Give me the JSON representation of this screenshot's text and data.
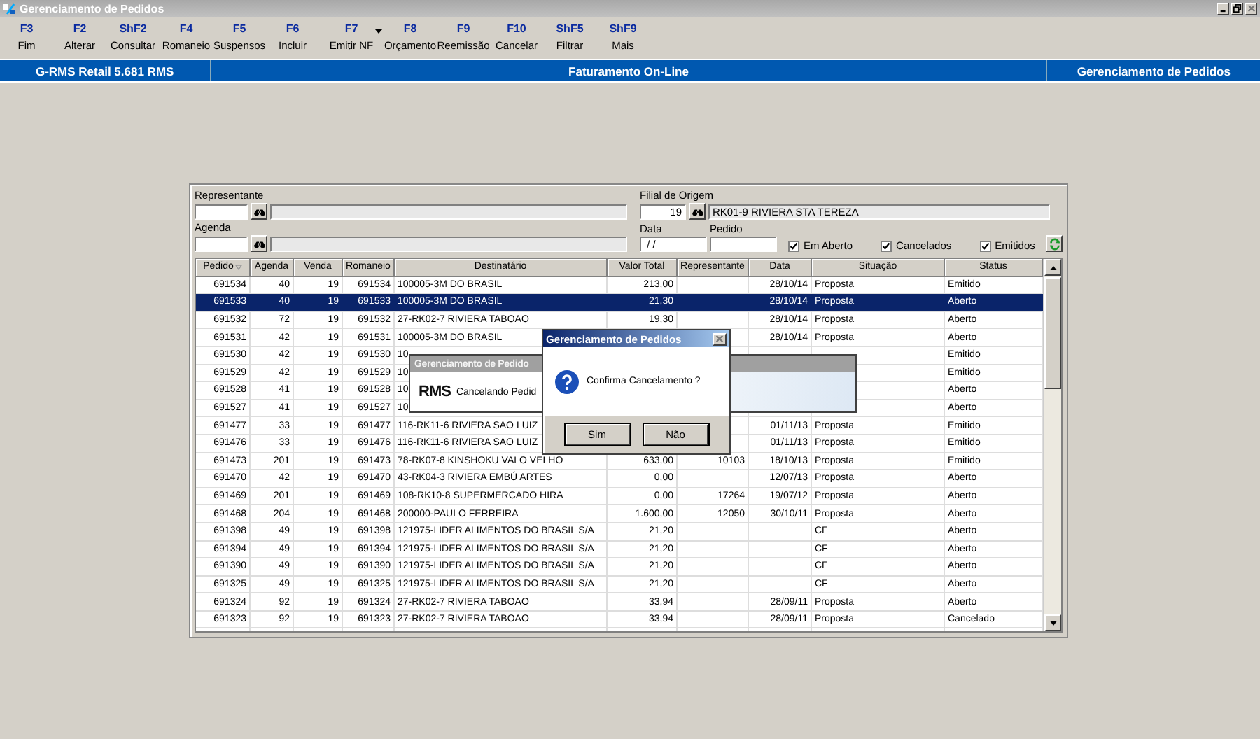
{
  "window": {
    "title": "Gerenciamento de Pedidos"
  },
  "toolbar": [
    {
      "key": "F3",
      "label": "Fim"
    },
    {
      "key": "F2",
      "label": "Alterar"
    },
    {
      "key": "ShF2",
      "label": "Consultar"
    },
    {
      "key": "F4",
      "label": "Romaneio"
    },
    {
      "key": "F5",
      "label": "Suspensos"
    },
    {
      "key": "F6",
      "label": "Incluir"
    },
    {
      "key": "F7",
      "label": "Emitir NF",
      "dropdown": true
    },
    {
      "key": "F8",
      "label": "Orçamento"
    },
    {
      "key": "F9",
      "label": "Reemissão"
    },
    {
      "key": "F10",
      "label": "Cancelar"
    },
    {
      "key": "ShF5",
      "label": "Filtrar"
    },
    {
      "key": "ShF9",
      "label": "Mais"
    }
  ],
  "status_bar": [
    "G-RMS Retail 5.681 RMS",
    "Faturamento On-Line",
    "Gerenciamento de Pedidos"
  ],
  "filters": {
    "representante": {
      "label": "Representante"
    },
    "agenda": {
      "label": "Agenda"
    },
    "filial": {
      "label": "Filial de Origem",
      "value": "19",
      "description": "RK01-9 RIVIERA STA TEREZA"
    },
    "data": {
      "label": "Data",
      "value": " / /"
    },
    "pedido": {
      "label": "Pedido"
    },
    "checkboxes": [
      {
        "label": "Em Aberto",
        "checked": true
      },
      {
        "label": "Cancelados",
        "checked": true
      },
      {
        "label": "Emitidos",
        "checked": true
      }
    ]
  },
  "table": {
    "columns": [
      {
        "label": "Pedido",
        "sorted": true
      },
      {
        "label": "Agenda",
        "sorted": false
      },
      {
        "label": "Venda",
        "sorted": false
      },
      {
        "label": "Romaneio",
        "sorted": false
      },
      {
        "label": "Destinatário",
        "sorted": false
      },
      {
        "label": "Valor Total",
        "sorted": false
      },
      {
        "label": "Representante",
        "sorted": false
      },
      {
        "label": "Data",
        "sorted": false
      },
      {
        "label": "Situação",
        "sorted": false
      },
      {
        "label": "Status",
        "sorted": false
      }
    ],
    "rows": [
      {
        "selected": false,
        "pedido": "691534",
        "agenda": "40",
        "venda": "19",
        "romaneio": "691534",
        "destinatario": "100005-3M DO BRASIL",
        "valor_total": "213,00",
        "data": "28/10/14",
        "situacao": "Proposta",
        "status": "Emitido"
      },
      {
        "selected": true,
        "pedido": "691533",
        "agenda": "40",
        "venda": "19",
        "romaneio": "691533",
        "destinatario": "100005-3M DO BRASIL",
        "valor_total": "21,30",
        "data": "28/10/14",
        "situacao": "Proposta",
        "status": "Aberto"
      },
      {
        "selected": false,
        "pedido": "691532",
        "agenda": "72",
        "venda": "19",
        "romaneio": "691532",
        "destinatario": "27-RK02-7 RIVIERA TABOAO",
        "valor_total": "19,30",
        "data": "28/10/14",
        "situacao": "Proposta",
        "status": "Aberto"
      },
      {
        "selected": false,
        "pedido": "691531",
        "agenda": "42",
        "venda": "19",
        "romaneio": "691531",
        "destinatario": "100005-3M DO BRASIL",
        "data": "28/10/14",
        "situacao": "Proposta",
        "status": "Aberto"
      },
      {
        "selected": false,
        "pedido": "691530",
        "agenda": "42",
        "venda": "19",
        "romaneio": "691530",
        "destinatario": "10",
        "status": "Emitido"
      },
      {
        "selected": false,
        "pedido": "691529",
        "agenda": "42",
        "venda": "19",
        "romaneio": "691529",
        "destinatario": "10",
        "status": "Emitido"
      },
      {
        "selected": false,
        "pedido": "691528",
        "agenda": "41",
        "venda": "19",
        "romaneio": "691528",
        "destinatario": "10",
        "status": "Aberto"
      },
      {
        "selected": false,
        "pedido": "691527",
        "agenda": "41",
        "venda": "19",
        "romaneio": "691527",
        "destinatario": "10",
        "status": "Aberto"
      },
      {
        "selected": false,
        "pedido": "691477",
        "agenda": "33",
        "venda": "19",
        "romaneio": "691477",
        "destinatario": "116-RK11-6 RIVIERA SAO LUIZ",
        "data": "01/11/13",
        "situacao": "Proposta",
        "status": "Emitido"
      },
      {
        "selected": false,
        "pedido": "691476",
        "agenda": "33",
        "venda": "19",
        "romaneio": "691476",
        "destinatario": "116-RK11-6 RIVIERA SAO LUIZ",
        "data": "01/11/13",
        "situacao": "Proposta",
        "status": "Emitido"
      },
      {
        "selected": false,
        "pedido": "691473",
        "agenda": "201",
        "venda": "19",
        "romaneio": "691473",
        "destinatario": "78-RK07-8 KINSHOKU VALO VELHO",
        "valor_total": "633,00",
        "representante": "10103",
        "data": "18/10/13",
        "situacao": "Proposta",
        "status": "Emitido"
      },
      {
        "selected": false,
        "pedido": "691470",
        "agenda": "42",
        "venda": "19",
        "romaneio": "691470",
        "destinatario": "43-RK04-3 RIVIERA EMBÚ ARTES",
        "valor_total": "0,00",
        "data": "12/07/13",
        "situacao": "Proposta",
        "status": "Aberto"
      },
      {
        "selected": false,
        "pedido": "691469",
        "agenda": "201",
        "venda": "19",
        "romaneio": "691469",
        "destinatario": "108-RK10-8 SUPERMERCADO HIRA",
        "valor_total": "0,00",
        "representante": "17264",
        "data": "19/07/12",
        "situacao": "Proposta",
        "status": "Aberto"
      },
      {
        "selected": false,
        "pedido": "691468",
        "agenda": "204",
        "venda": "19",
        "romaneio": "691468",
        "destinatario": "200000-PAULO FERREIRA",
        "valor_total": "1.600,00",
        "representante": "12050",
        "data": "30/10/11",
        "situacao": "Proposta",
        "status": "Aberto"
      },
      {
        "selected": false,
        "pedido": "691398",
        "agenda": "49",
        "venda": "19",
        "romaneio": "691398",
        "destinatario": "121975-LIDER ALIMENTOS DO BRASIL S/A",
        "valor_total": "21,20",
        "situacao": "CF",
        "status": "Aberto"
      },
      {
        "selected": false,
        "pedido": "691394",
        "agenda": "49",
        "venda": "19",
        "romaneio": "691394",
        "destinatario": "121975-LIDER ALIMENTOS DO BRASIL S/A",
        "valor_total": "21,20",
        "situacao": "CF",
        "status": "Aberto"
      },
      {
        "selected": false,
        "pedido": "691390",
        "agenda": "49",
        "venda": "19",
        "romaneio": "691390",
        "destinatario": "121975-LIDER ALIMENTOS DO BRASIL S/A",
        "valor_total": "21,20",
        "situacao": "CF",
        "status": "Aberto"
      },
      {
        "selected": false,
        "pedido": "691325",
        "agenda": "49",
        "venda": "19",
        "romaneio": "691325",
        "destinatario": "121975-LIDER ALIMENTOS DO BRASIL S/A",
        "valor_total": "21,20",
        "situacao": "CF",
        "status": "Aberto"
      },
      {
        "selected": false,
        "pedido": "691324",
        "agenda": "92",
        "venda": "19",
        "romaneio": "691324",
        "destinatario": "27-RK02-7 RIVIERA TABOAO",
        "valor_total": "33,94",
        "data": "28/09/11",
        "situacao": "Proposta",
        "status": "Aberto"
      },
      {
        "selected": false,
        "pedido": "691323",
        "agenda": "92",
        "venda": "19",
        "romaneio": "691323",
        "destinatario": "27-RK02-7 RIVIERA TABOAO",
        "valor_total": "33,94",
        "data": "28/09/11",
        "situacao": "Proposta",
        "status": "Cancelado"
      }
    ]
  },
  "progress_dialog": {
    "title": "Gerenciamento de Pedido",
    "logo": "RMS",
    "message": "Cancelando Pedid"
  },
  "confirm_dialog": {
    "title": "Gerenciamento de Pedidos",
    "message": "Confirma Cancelamento ?",
    "buttons": [
      "Sim",
      "Não"
    ]
  }
}
